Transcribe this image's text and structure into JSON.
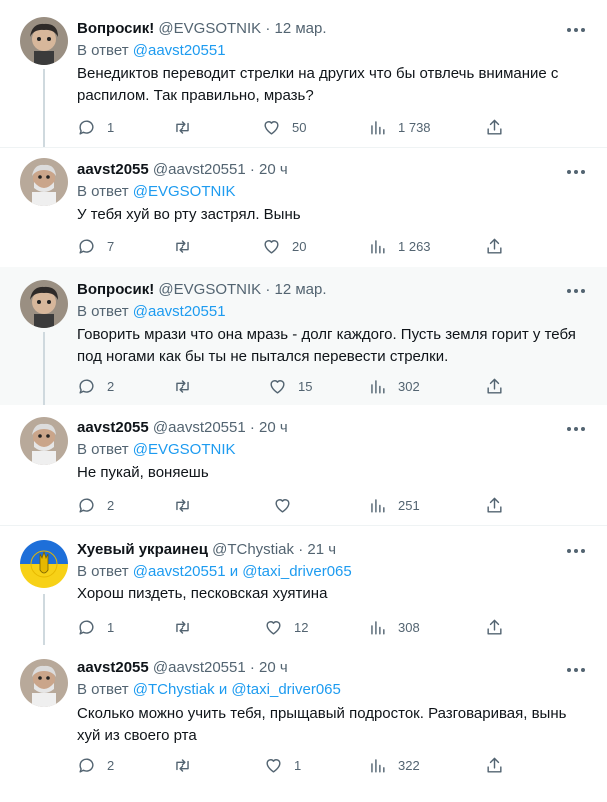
{
  "tweets": [
    {
      "name": "Вопросик!",
      "handle": "@EVGSOTNIK",
      "time": "12 мар.",
      "reply_prefix": "В ответ",
      "mentions": [
        "@aavst20551"
      ],
      "mention_sep": "",
      "text": "Венедиктов переводит стрелки на других что бы отвлечь внимание с распилом. Так правильно, мразь?",
      "counts": {
        "reply": "1",
        "retweet": "",
        "like": "50",
        "views": "1 738"
      },
      "avatar": "avatar-a"
    },
    {
      "name": "aavst2055",
      "handle": "@aavst20551",
      "time": "20 ч",
      "reply_prefix": "В ответ",
      "mentions": [
        "@EVGSOTNIK"
      ],
      "mention_sep": "",
      "text": "У тебя хуй во рту застрял. Вынь",
      "counts": {
        "reply": "7",
        "retweet": "",
        "like": "20",
        "views": "1 263"
      },
      "avatar": "avatar-b"
    },
    {
      "name": "Вопросик!",
      "handle": "@EVGSOTNIK",
      "time": "12 мар.",
      "reply_prefix": "В ответ",
      "mentions": [
        "@aavst20551"
      ],
      "mention_sep": "",
      "text": "Говорить мрази что она мразь - долг каждого. Пусть земля горит у тебя под ногами как бы ты не пытался перевести стрелки.",
      "counts": {
        "reply": "2",
        "retweet": "",
        "like": "15",
        "views": "302"
      },
      "avatar": "avatar-a"
    },
    {
      "name": "aavst2055",
      "handle": "@aavst20551",
      "time": "20 ч",
      "reply_prefix": "В ответ",
      "mentions": [
        "@EVGSOTNIK"
      ],
      "mention_sep": "",
      "text": "Не пукай, воняешь",
      "counts": {
        "reply": "2",
        "retweet": "",
        "like": "",
        "views": "251"
      },
      "avatar": "avatar-b"
    },
    {
      "name": "Хуевый украинец",
      "handle": "@TChystiak",
      "time": "21 ч",
      "reply_prefix": "В ответ",
      "mentions": [
        "@aavst20551",
        "@taxi_driver065"
      ],
      "mention_sep": "и",
      "text": "Хорош пиздеть, песковская хуятина",
      "counts": {
        "reply": "1",
        "retweet": "",
        "like": "12",
        "views": "308"
      },
      "avatar": "avatar-ua"
    },
    {
      "name": "aavst2055",
      "handle": "@aavst20551",
      "time": "20 ч",
      "reply_prefix": "В ответ",
      "mentions": [
        "@TChystiak",
        "@taxi_driver065"
      ],
      "mention_sep": "и",
      "text": "Сколько можно учить тебя, прыщавый подросток. Разговаривая, вынь хуй из своего рта",
      "counts": {
        "reply": "2",
        "retweet": "",
        "like": "1",
        "views": "322"
      },
      "avatar": "avatar-b"
    }
  ],
  "separator": "·",
  "icons": {
    "reply": "reply-icon",
    "retweet": "retweet-icon",
    "like": "heart-icon",
    "views": "views-icon",
    "share": "share-icon",
    "more": "more-icon"
  },
  "colors": {
    "accent": "#1d9bf0",
    "secondary": "#536471",
    "highlight": "#f7f9f9",
    "divider": "#eff3f4"
  }
}
